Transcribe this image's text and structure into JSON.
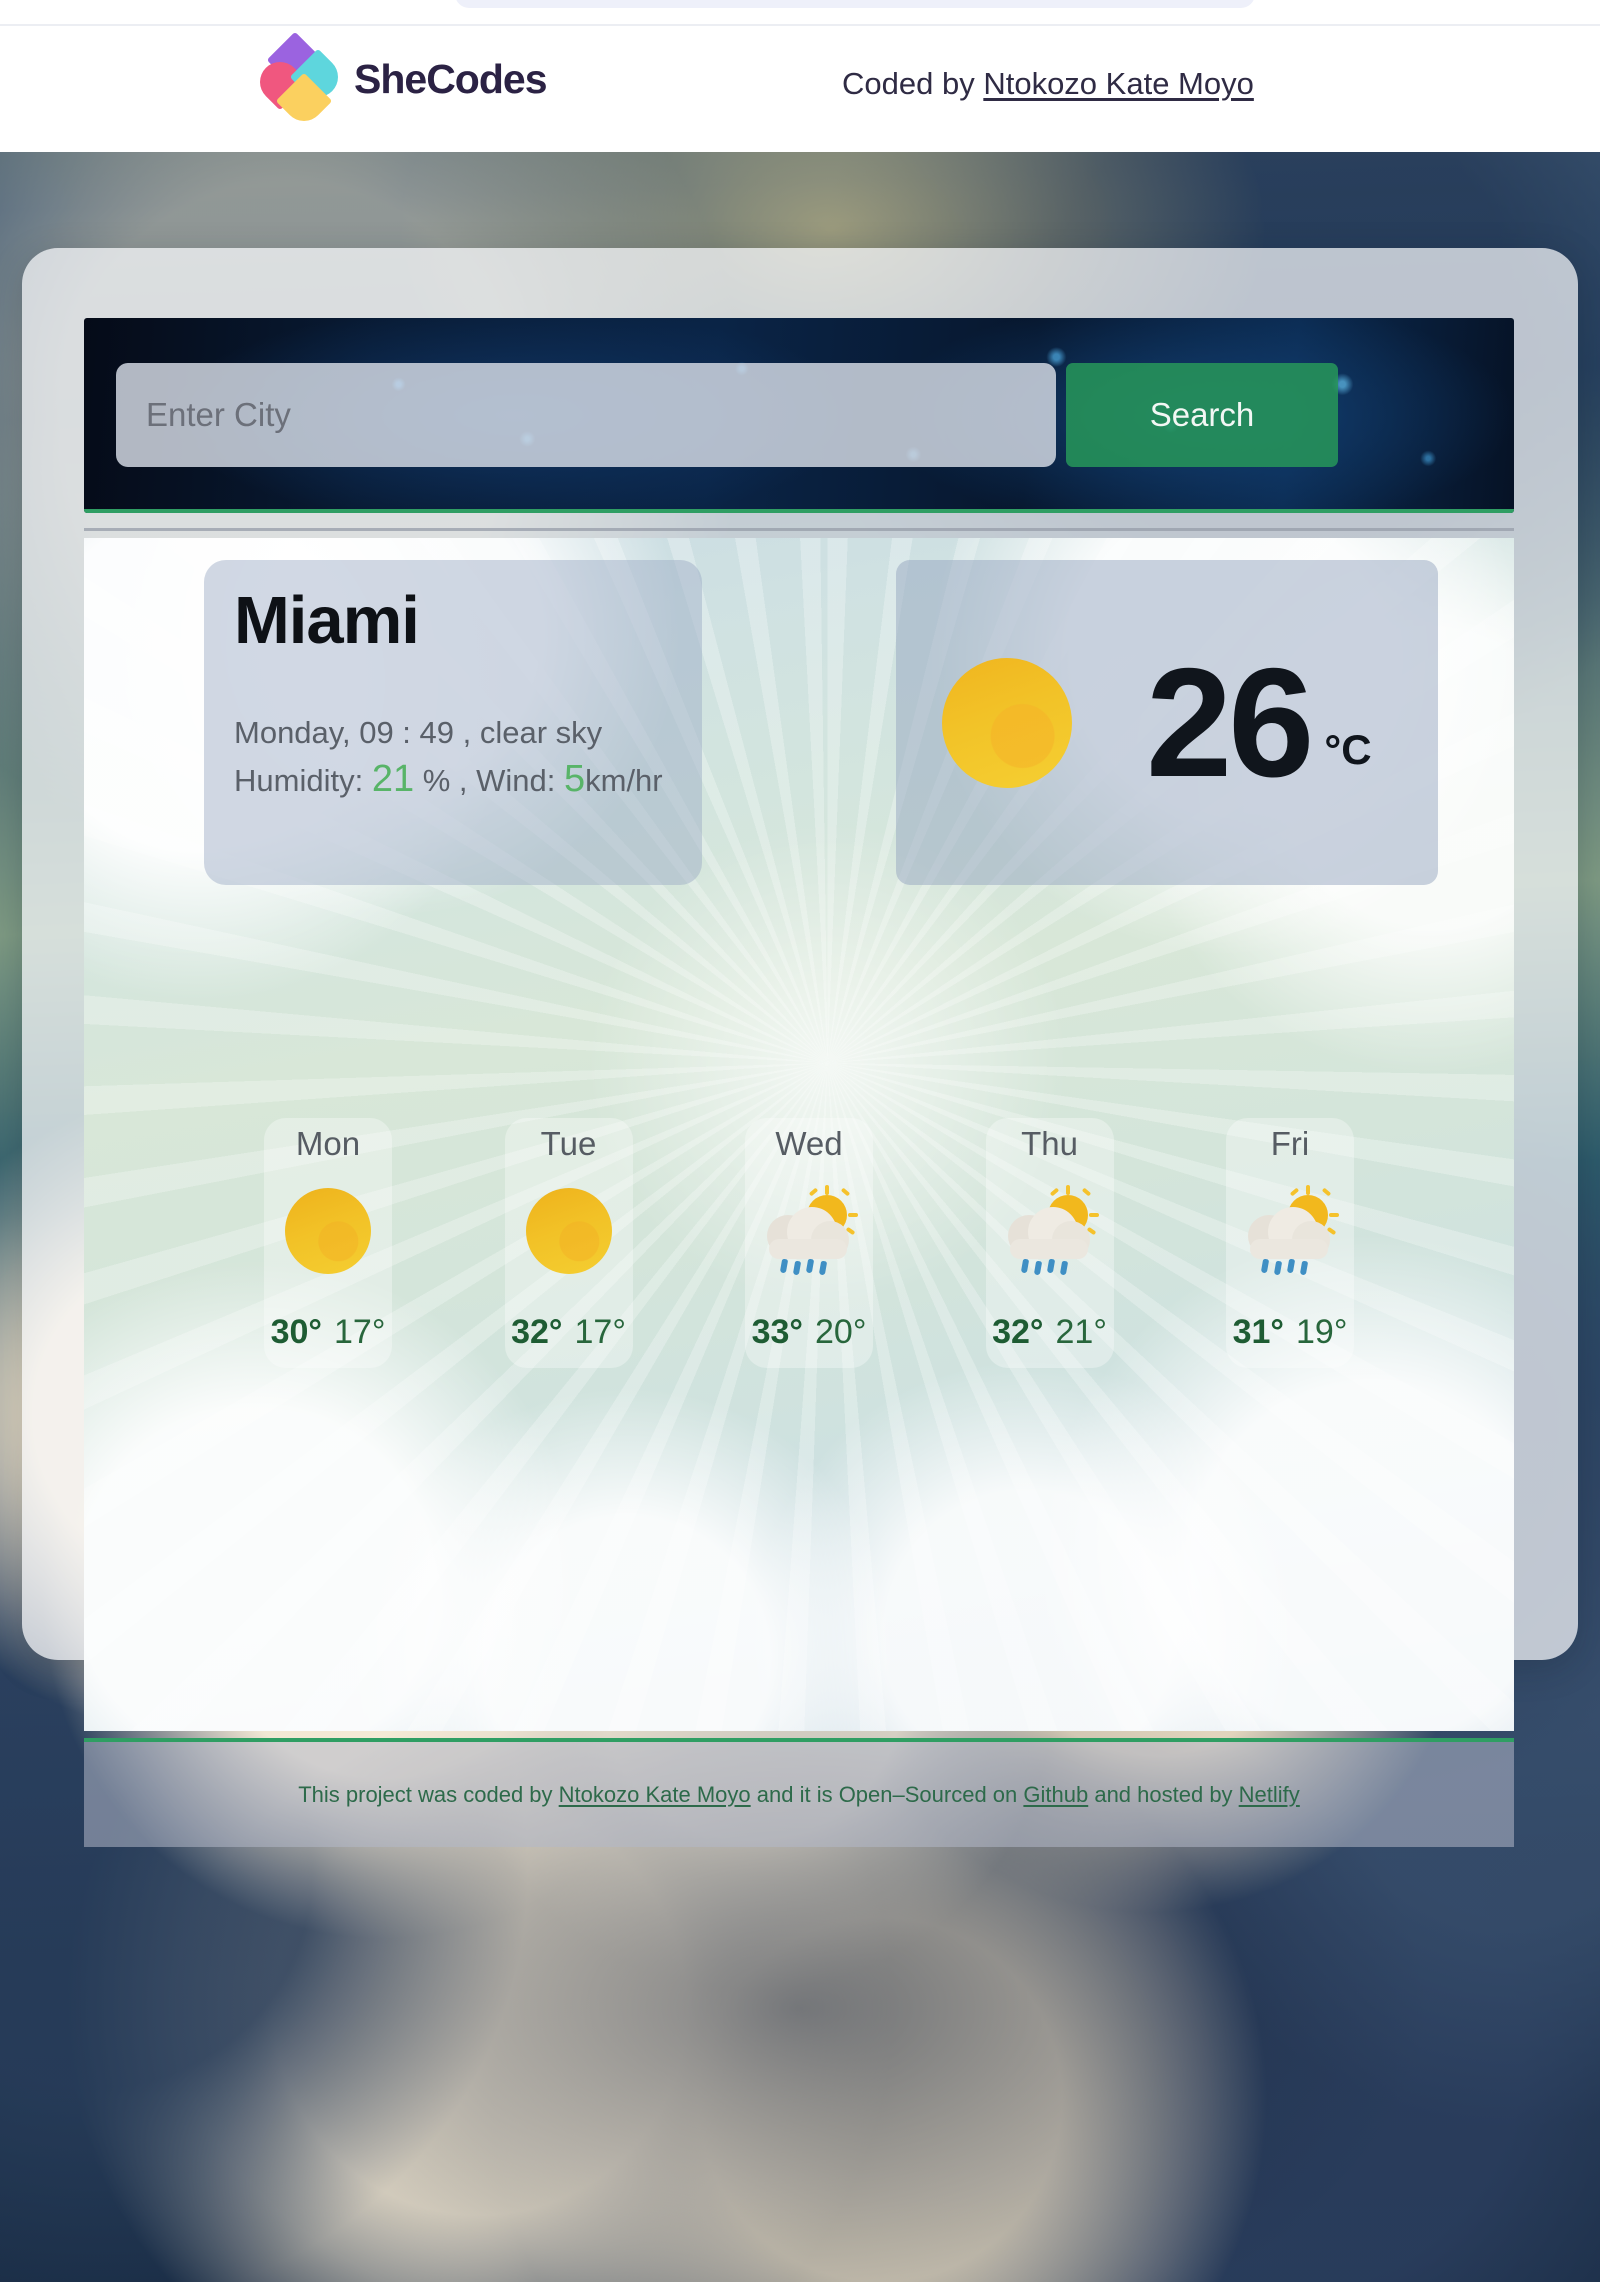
{
  "header": {
    "logo_word": "SheCodes",
    "coded_by_prefix": "Coded by ",
    "author": "Ntokozo Kate Moyo"
  },
  "search": {
    "placeholder": "Enter City",
    "value": "",
    "button_label": "Search"
  },
  "current": {
    "city": "Miami",
    "day_time_condition": "Monday, 09 : 49 , clear sky",
    "humidity_label": "Humidity: ",
    "humidity_value": "21",
    "humidity_unit": " % ",
    "wind_label": ", Wind: ",
    "wind_value": "5",
    "wind_unit": "km/hr",
    "temperature": "26",
    "unit": "°C",
    "icon": "sun-icon"
  },
  "forecast": [
    {
      "day": "Mon",
      "icon": "sun-icon",
      "max": "30°",
      "min": "17°"
    },
    {
      "day": "Tue",
      "icon": "sun-icon",
      "max": "32°",
      "min": "17°"
    },
    {
      "day": "Wed",
      "icon": "sun-rain-icon",
      "max": "33°",
      "min": "20°"
    },
    {
      "day": "Thu",
      "icon": "sun-rain-icon",
      "max": "32°",
      "min": "21°"
    },
    {
      "day": "Fri",
      "icon": "sun-rain-icon",
      "max": "31°",
      "min": "19°"
    }
  ],
  "footer": {
    "part1": "This project was coded by ",
    "author": "Ntokozo Kate Moyo",
    "part2": " and it is Open–Sourced on ",
    "github": "Github",
    "part3": " and hosted by ",
    "netlify": "Netlify"
  },
  "colors": {
    "accent_green": "#2f9e63",
    "value_green": "#58b468",
    "forecast_green": "#1e5c33",
    "brand_dark": "#2b2244",
    "sun_yellow": "#f2c227"
  }
}
